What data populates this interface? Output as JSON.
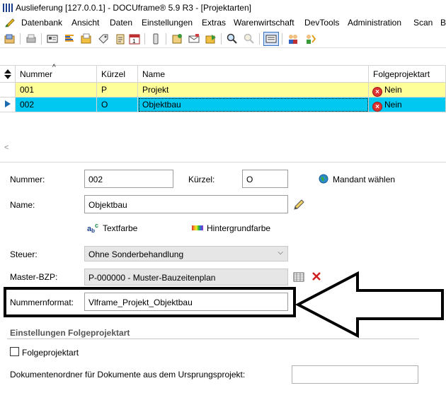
{
  "window": {
    "title": "Auslieferung [127.0.0.1] - DOCUframe® 5.9 R3 - [Projektarten]"
  },
  "menu": {
    "items": [
      "Datenbank",
      "Ansicht",
      "Daten",
      "Einstellungen",
      "Extras",
      "Warenwirtschaft",
      "DevTools",
      "Administration",
      "Scan",
      "B"
    ]
  },
  "grid": {
    "columns": [
      "Nummer",
      "Kürzel",
      "Name",
      "Folgeprojektart"
    ],
    "rows": [
      {
        "nummer": "001",
        "kuerzel": "P",
        "name": "Projekt",
        "folge": "Nein"
      },
      {
        "nummer": "002",
        "kuerzel": "O",
        "name": "Objektbau",
        "folge": "Nein"
      }
    ],
    "scroll_left": "<"
  },
  "form": {
    "nummer_label": "Nummer:",
    "nummer_value": "002",
    "kuerzel_label": "Kürzel:",
    "kuerzel_value": "O",
    "mandant_label": "Mandant wählen",
    "name_label": "Name:",
    "name_value": "Objektbau",
    "textfarbe_label": "Textfarbe",
    "hintergrundfarbe_label": "Hintergrundfarbe",
    "steuer_label": "Steuer:",
    "steuer_value": "Ohne Sonderbehandlung",
    "master_label": "Master-BZP:",
    "master_value": "P-000000 - Muster-Bauzeitenplan",
    "nummernformat_label": "Nummernformat:",
    "nummernformat_value": "Vlframe_Projekt_Objektbau",
    "section_title": "Einstellungen Folgeprojektart",
    "folge_checkbox_label": "Folgeprojektart",
    "folge_checked": false,
    "dokumentenordner_label": "Dokumentenordner für Dokumente aus dem Ursprungsprojekt:",
    "dokumentenordner_value": ""
  },
  "colors": {
    "row_yellow": "#ffff99",
    "row_cyan": "#00c8f0",
    "nein_red": "#dd3333"
  }
}
